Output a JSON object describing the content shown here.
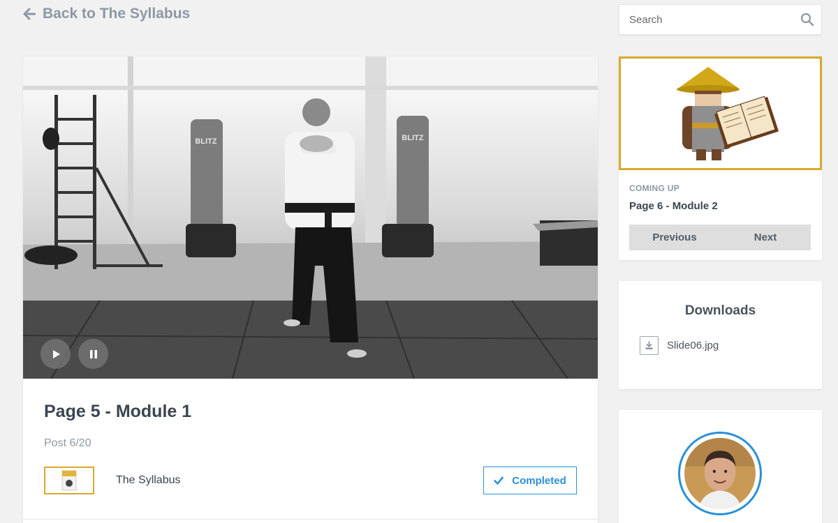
{
  "nav": {
    "back_label": "Back to The Syllabus"
  },
  "search": {
    "placeholder": "Search"
  },
  "lesson": {
    "title": "Page 5 - Module 1",
    "post_count": "Post 6/20",
    "course_name": "The Syllabus",
    "completed_label": "Completed",
    "bag_brand_left": "BLITZ",
    "bag_brand_right": "BLITZ"
  },
  "coming_up": {
    "label": "COMING UP",
    "title": "Page 6 - Module 2",
    "previous_label": "Previous",
    "next_label": "Next"
  },
  "downloads": {
    "title": "Downloads",
    "items": [
      {
        "name": "Slide06.jpg"
      }
    ]
  },
  "colors": {
    "accent_blue": "#2b8fd6",
    "gold_border": "#d8a92b",
    "muted_text": "#8d97a3"
  },
  "icons": {
    "back": "arrow-left-icon",
    "search": "search-icon",
    "play": "play-icon",
    "pause": "pause-icon",
    "check": "check-icon",
    "download": "download-icon"
  }
}
